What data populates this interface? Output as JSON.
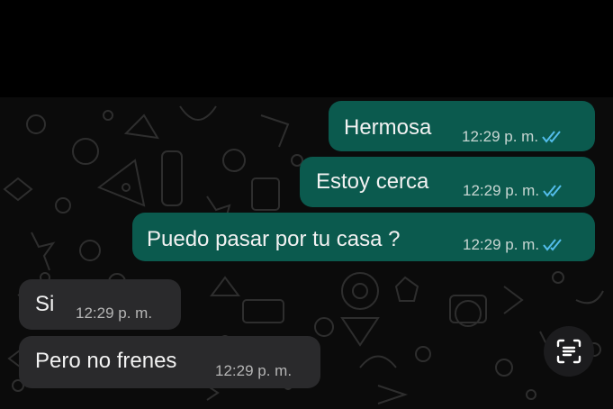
{
  "messages": [
    {
      "direction": "outgoing",
      "text": "Hermosa",
      "time": "12:29 p. m.",
      "status": "read"
    },
    {
      "direction": "outgoing",
      "text": "Estoy cerca",
      "time": "12:29 p. m.",
      "status": "read"
    },
    {
      "direction": "outgoing",
      "text": "Puedo pasar por tu casa ?",
      "time": "12:29 p. m.",
      "status": "read"
    },
    {
      "direction": "incoming",
      "text": "Si",
      "time": "12:29 p. m."
    },
    {
      "direction": "incoming",
      "text": "Pero no frenes",
      "time": "12:29 p. m."
    }
  ],
  "icons": {
    "read_receipt": "double-check-icon",
    "scan_button": "text-scan-icon"
  },
  "colors": {
    "outgoing_bubble": "#0b5a4e",
    "incoming_bubble": "#2a2a2c",
    "read_ticks": "#53bdeb",
    "background": "#0b0b0b"
  }
}
